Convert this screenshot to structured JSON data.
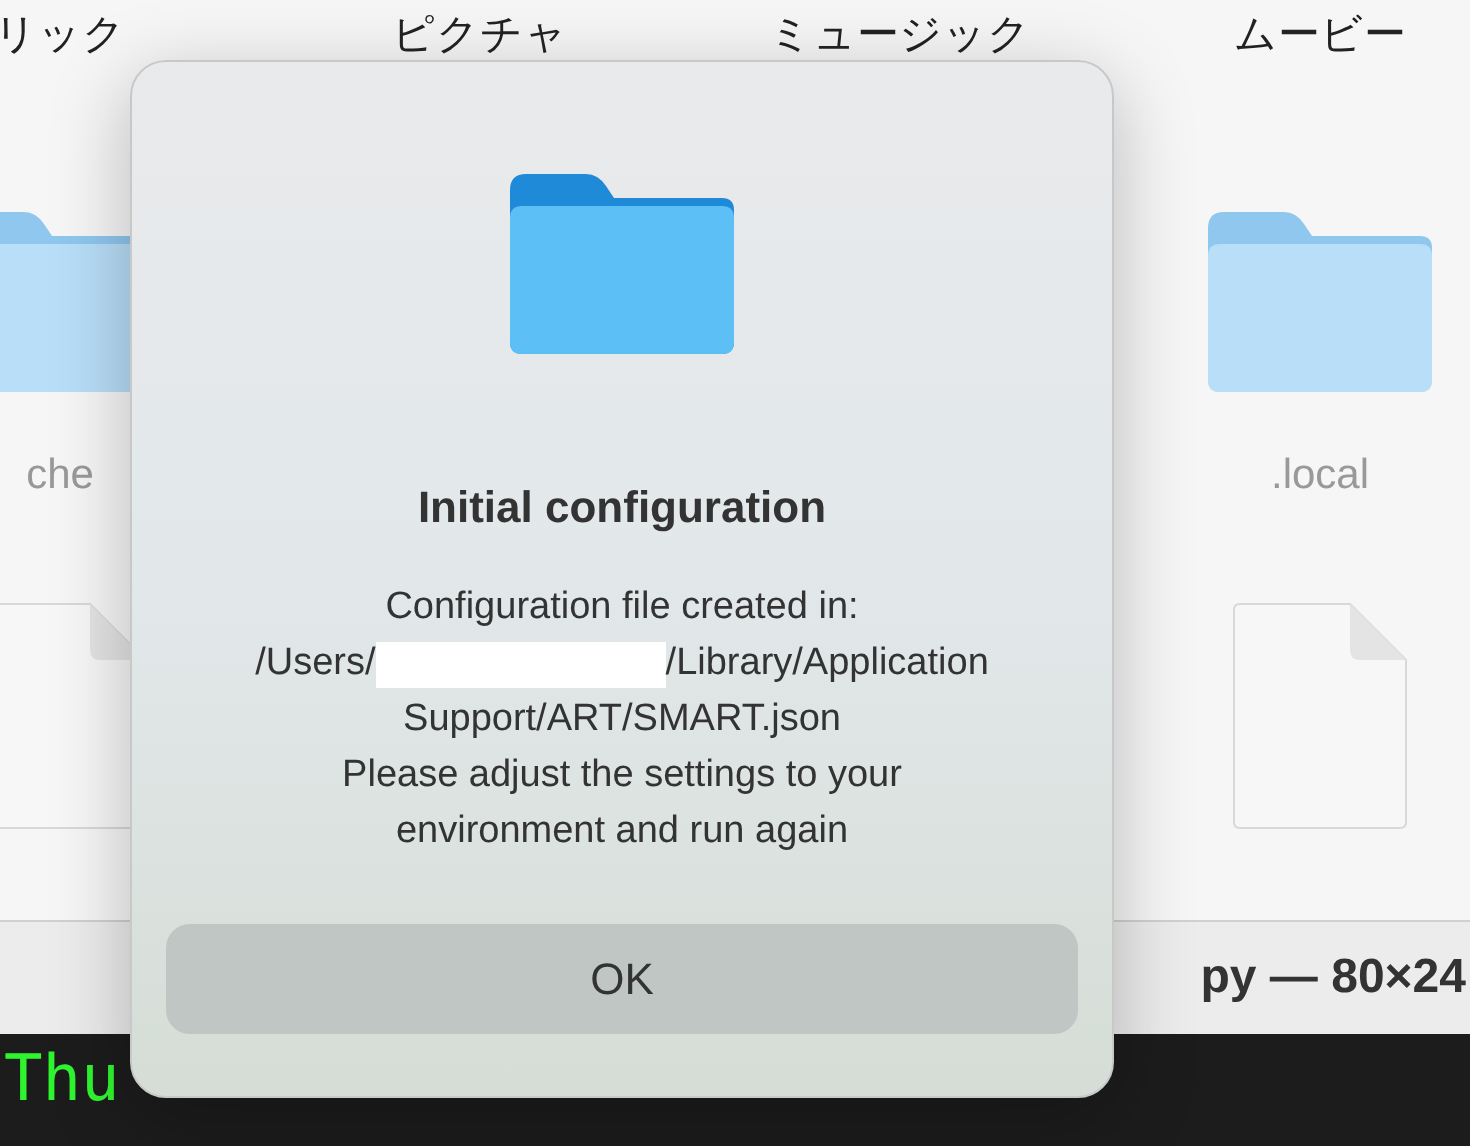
{
  "finder": {
    "columns": [
      {
        "label": "リック",
        "kind": "folder",
        "name": "che"
      },
      {
        "label": "ピクチャ"
      },
      {
        "label": "ミュージック"
      },
      {
        "label": "ムービー",
        "kind": "folder",
        "name": ".local"
      }
    ]
  },
  "terminal": {
    "title": "py — 80×24",
    "lines": [
      "Thu"
    ]
  },
  "dialog": {
    "title": "Initial configuration",
    "message": [
      {
        "kind": "text",
        "text": "Configuration file created in:"
      },
      {
        "kind": "redacted",
        "before": "/Users/",
        "after": "/Library/Application"
      },
      {
        "kind": "text",
        "text": "Support/ART/SMART.json"
      },
      {
        "kind": "text",
        "text": "Please adjust the settings to your"
      },
      {
        "kind": "text",
        "text": "environment and run again"
      }
    ],
    "button": "OK"
  }
}
